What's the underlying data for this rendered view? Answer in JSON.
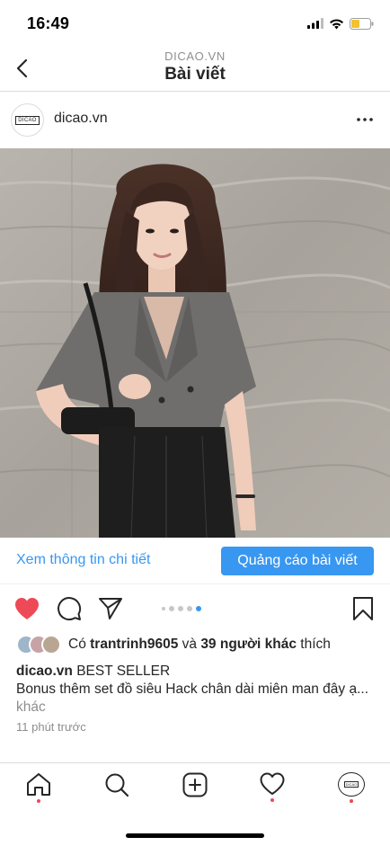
{
  "status_bar": {
    "time": "16:49"
  },
  "header": {
    "subtitle": "DICAO.VN",
    "title": "Bài viết"
  },
  "post": {
    "avatar_text": "DICAO",
    "username": "dicao.vn",
    "cta_link": "Xem thông tin chi tiết",
    "cta_button": "Quảng cáo bài viết",
    "carousel": {
      "total": 5,
      "active_index": 4
    },
    "likes": {
      "prefix": "Có ",
      "user": "trantrinh9605",
      "connector": " và ",
      "others": "39 người khác",
      "suffix": " thích"
    },
    "caption": {
      "username": "dicao.vn",
      "line1": " BEST SELLER",
      "line2": "Bonus thêm set đồ siêu Hack chân dài miên man đây ạ...",
      "more": "khác"
    },
    "timestamp": "11 phút trước"
  },
  "bottom_nav": {
    "profile_avatar_text": "DICAO",
    "tabs": [
      "home",
      "search",
      "new-post",
      "activity",
      "profile"
    ]
  },
  "colors": {
    "accent": "#3897f0",
    "like": "#ed4956",
    "text": "#262626",
    "muted": "#8e8e8e"
  }
}
